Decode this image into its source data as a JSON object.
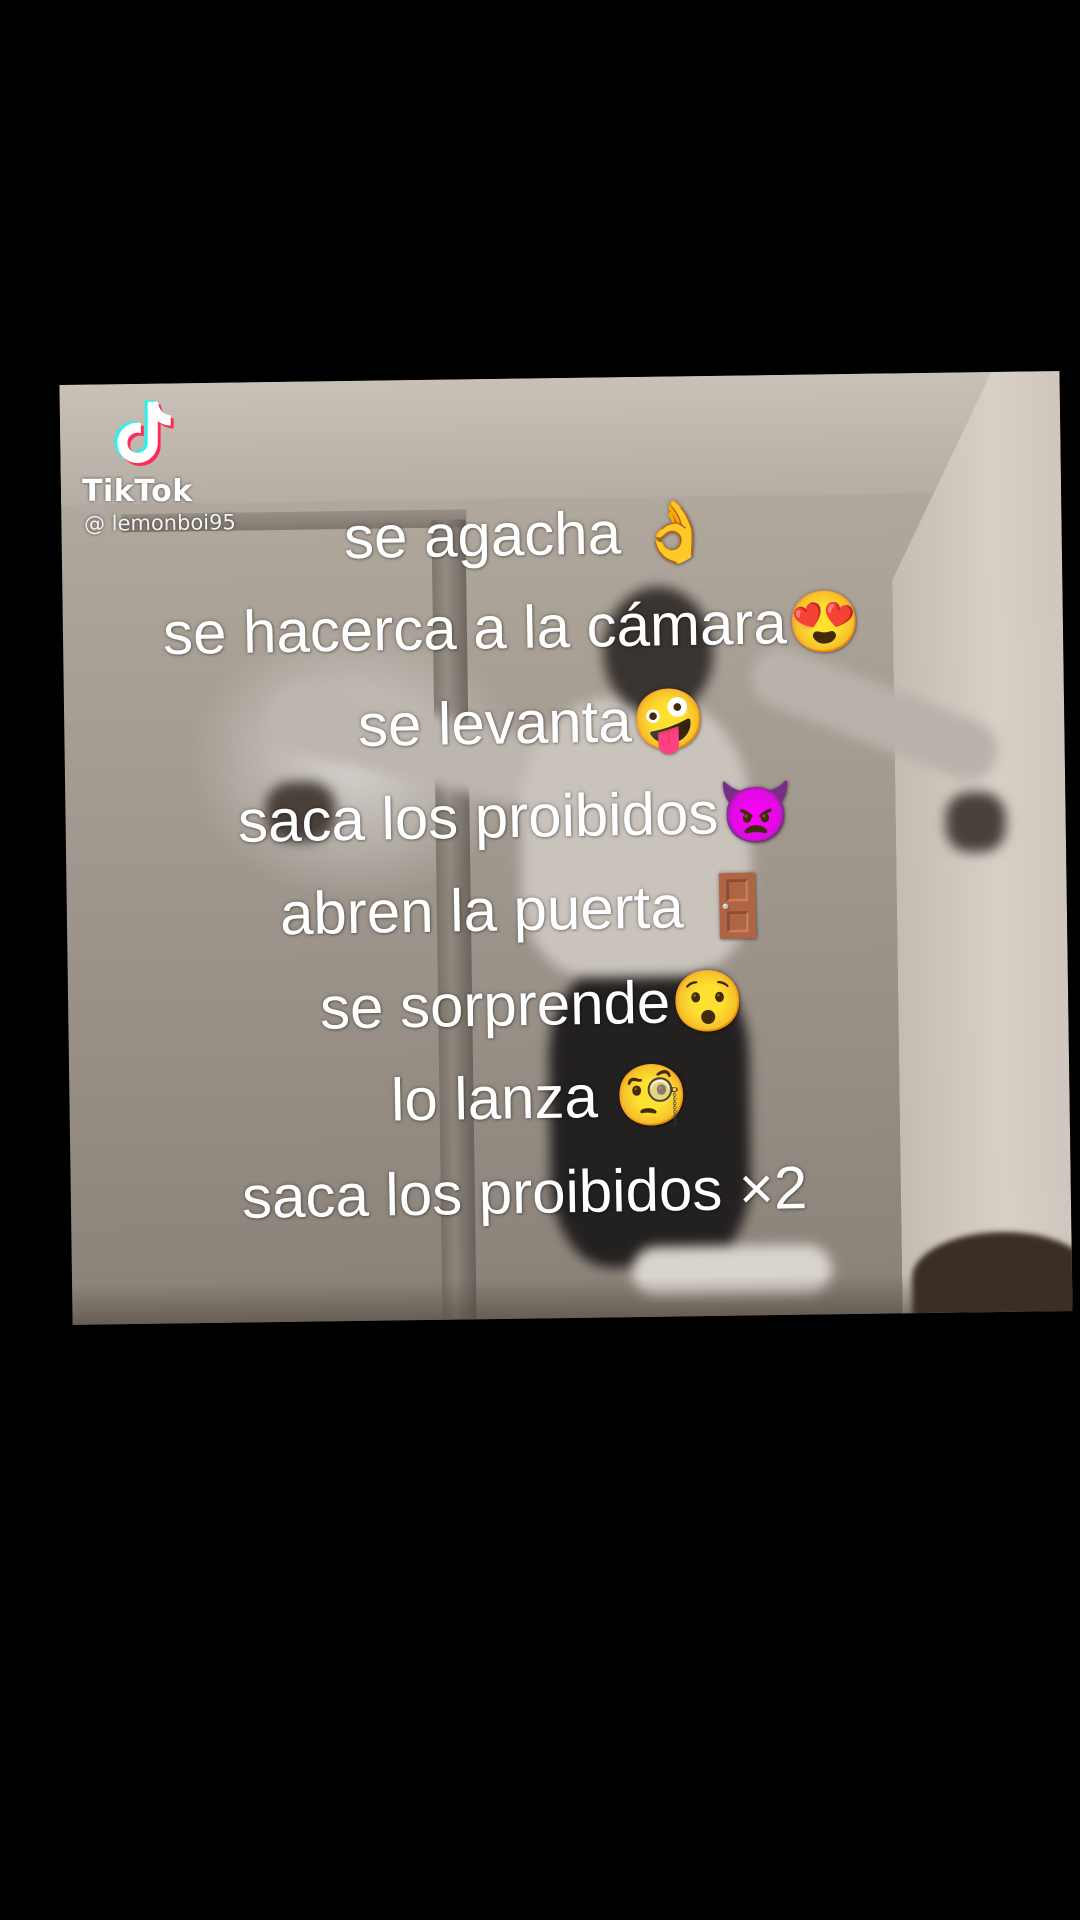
{
  "watermark": {
    "app_name": "TikTok",
    "handle": "@ lemonboi95",
    "icon": "tiktok-note-icon"
  },
  "captions": [
    "se agacha 👌",
    "se hacerca a la cámara😍",
    "se levanta🤪",
    "saca los proibidos👿",
    "abren la puerta 🚪",
    "se sorprende😯",
    "lo lanza 🧐",
    "saca los proibidos ×2"
  ],
  "colors": {
    "background": "#000000",
    "caption_text": "#ffffff",
    "tiktok_cyan": "#25f4ee",
    "tiktok_red": "#fe2c55"
  }
}
